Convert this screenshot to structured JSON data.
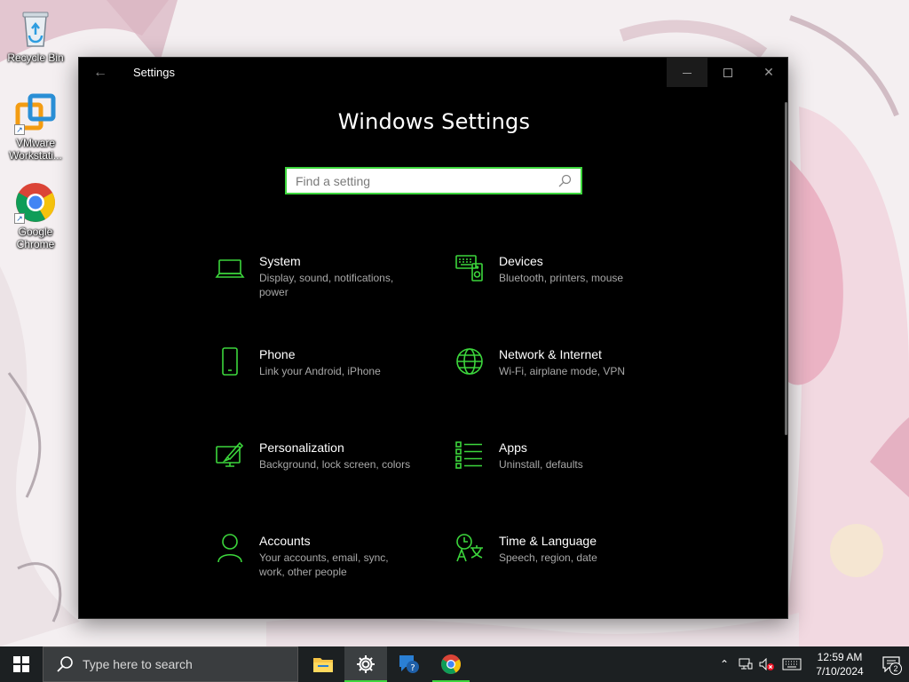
{
  "desktop": {
    "icons": [
      {
        "label": "Recycle Bin",
        "icon": "recycle-bin-icon"
      },
      {
        "label": "VMware Workstati...",
        "icon": "vmware-icon"
      },
      {
        "label": "Google Chrome",
        "icon": "chrome-icon"
      }
    ]
  },
  "window": {
    "title": "Settings",
    "heading": "Windows Settings",
    "search_placeholder": "Find a setting",
    "accent_color": "#3cd63c",
    "categories": [
      {
        "title": "System",
        "subtitle": "Display, sound, notifications, power",
        "icon": "laptop-icon"
      },
      {
        "title": "Devices",
        "subtitle": "Bluetooth, printers, mouse",
        "icon": "keyboard-speaker-icon"
      },
      {
        "title": "Phone",
        "subtitle": "Link your Android, iPhone",
        "icon": "phone-icon"
      },
      {
        "title": "Network & Internet",
        "subtitle": "Wi-Fi, airplane mode, VPN",
        "icon": "globe-icon"
      },
      {
        "title": "Personalization",
        "subtitle": "Background, lock screen, colors",
        "icon": "paint-monitor-icon"
      },
      {
        "title": "Apps",
        "subtitle": "Uninstall, defaults",
        "icon": "apps-list-icon"
      },
      {
        "title": "Accounts",
        "subtitle": "Your accounts, email, sync, work, other people",
        "icon": "person-icon"
      },
      {
        "title": "Time & Language",
        "subtitle": "Speech, region, date",
        "icon": "time-language-icon"
      }
    ]
  },
  "taskbar": {
    "search_text": "Type here to search",
    "apps": [
      {
        "name": "File Explorer",
        "icon": "folder-icon"
      },
      {
        "name": "Settings",
        "icon": "gear-icon"
      },
      {
        "name": "Tips",
        "icon": "tips-icon"
      },
      {
        "name": "Google Chrome",
        "icon": "chrome-icon"
      }
    ],
    "clock": {
      "time": "12:59 AM",
      "date": "7/10/2024"
    },
    "notification_count": "2"
  }
}
